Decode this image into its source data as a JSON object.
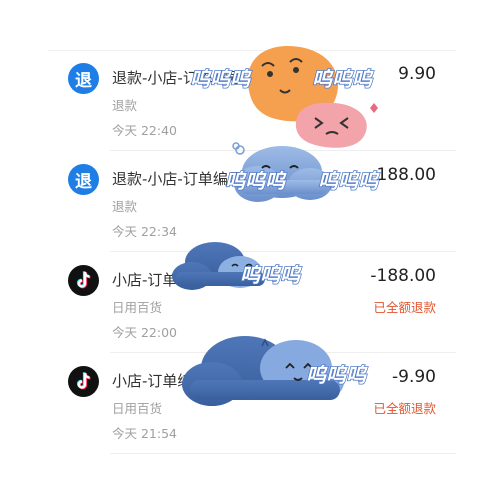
{
  "transactions": [
    {
      "icon": "refund-icon",
      "icon_char": "退",
      "title": "退款-小店-订单编号",
      "amount": "9.90",
      "category": "退款",
      "time": "今天  22:40",
      "status": ""
    },
    {
      "icon": "refund-icon",
      "icon_char": "退",
      "title": "退款-小店-订单编号",
      "amount": "188.00",
      "category": "退款",
      "time": "今天  22:34",
      "status": ""
    },
    {
      "icon": "tiktok-icon",
      "icon_char": "",
      "title": "小店-订单编号",
      "amount": "-188.00",
      "category": "日用百货",
      "time": "今天  22:00",
      "status": "已全额退款"
    },
    {
      "icon": "tiktok-icon",
      "icon_char": "",
      "title": "小店-订单编号",
      "amount": "-9.90",
      "category": "日用百货",
      "time": "今天  21:54",
      "status": "已全额退款"
    }
  ],
  "stickers": {
    "text": "呜呜呜"
  },
  "colors": {
    "refund_icon": "#1e7ee6",
    "status": "#e0552f",
    "cloud": "#7a9fd6",
    "orange": "#f5a04f",
    "pink": "#f3a3aa"
  }
}
